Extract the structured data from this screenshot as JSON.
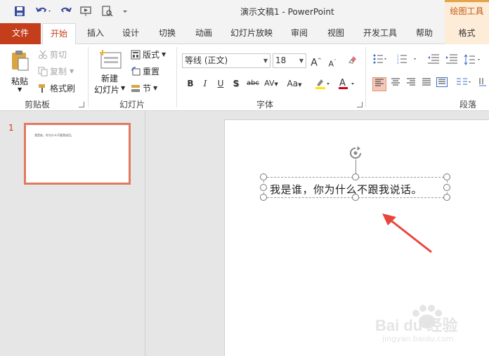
{
  "app": {
    "doc_title": "演示文稿1  -  PowerPoint",
    "contextual_tab_group": "绘图工具"
  },
  "tabs": [
    "文件",
    "开始",
    "插入",
    "设计",
    "切换",
    "动画",
    "幻灯片放映",
    "审阅",
    "视图",
    "开发工具",
    "帮助",
    "格式"
  ],
  "ribbon": {
    "clipboard": {
      "paste": "粘贴",
      "cut": "剪切",
      "copy": "复制",
      "format_painter": "格式刷",
      "group_label": "剪贴板"
    },
    "slides": {
      "new_slide_line1": "新建",
      "new_slide_line2": "幻灯片",
      "layout": "版式",
      "reset": "重置",
      "section": "节",
      "group_label": "幻灯片"
    },
    "font": {
      "font_name": "等线 (正文)",
      "font_size": "18",
      "group_label": "字体",
      "case_label": "Aa"
    },
    "paragraph": {
      "group_label": "段落"
    }
  },
  "thumbnail_pane": {
    "slide_number": "1",
    "thumb_text": "我是谁，你为什么不跟我说话。"
  },
  "slide": {
    "textbox_text": "我是谁，你为什么不跟我说话。"
  },
  "watermark": {
    "brand": "Bai du 经验",
    "url": "jingyan.baidu.com"
  },
  "colors": {
    "file_tab": "#c43e1c",
    "accent": "#c43e1c",
    "contextual": "#fcecd8",
    "arrow": "#e8453c"
  }
}
